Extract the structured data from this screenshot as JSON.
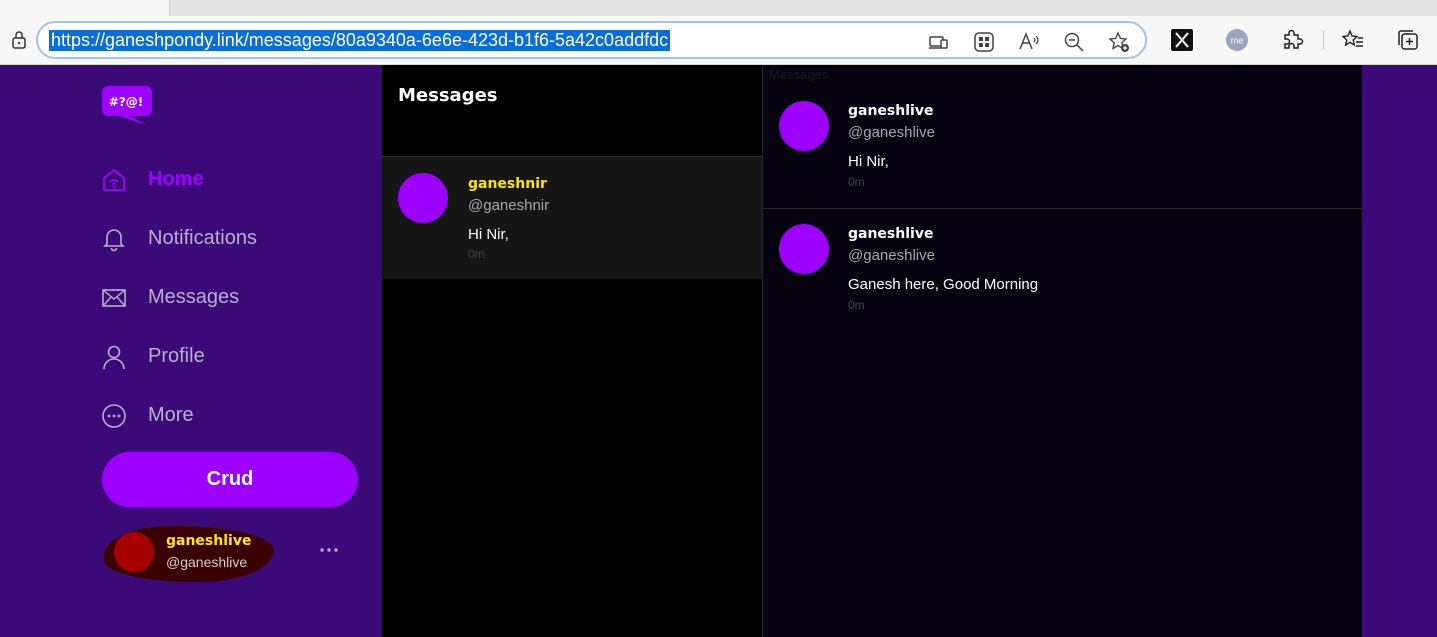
{
  "browser": {
    "url": "https://ganeshpondy.link/messages/80a9340a-6e6e-423d-b1f6-5a42c0addfdc",
    "toolbar_icons": [
      "app-available-icon",
      "apps-icon",
      "read-aloud-icon",
      "zoom-out-icon",
      "add-favorite-icon",
      "x-twitter-icon",
      "me-profile-icon",
      "extensions-icon",
      "favorites-icon",
      "collections-icon"
    ]
  },
  "colors": {
    "sidebar_bg": "#3c0a78",
    "accent": "#9d00ff",
    "highlight_name": "#ffe500"
  },
  "logo": {
    "text": "#?@!"
  },
  "nav": {
    "items": [
      {
        "label": "Home",
        "icon": "home-icon",
        "active": true
      },
      {
        "label": "Notifications",
        "icon": "bell-icon"
      },
      {
        "label": "Messages",
        "icon": "mail-icon"
      },
      {
        "label": "Profile",
        "icon": "user-icon"
      },
      {
        "label": "More",
        "icon": "more-circle-icon"
      }
    ]
  },
  "crud_button": {
    "label": "Crud"
  },
  "account": {
    "name": "ganeshlive",
    "handle": "@ganeshlive"
  },
  "conversations": {
    "title": "Messages",
    "items": [
      {
        "name": "ganeshnir",
        "handle": "@ganeshnir",
        "text": "Hi Nir,",
        "time": "0m"
      }
    ]
  },
  "thread": {
    "label": "Messages",
    "messages": [
      {
        "name": "ganeshlive",
        "handle": "@ganeshlive",
        "text": "Hi Nir,",
        "time": "0m"
      },
      {
        "name": "ganeshlive",
        "handle": "@ganeshlive",
        "text": "Ganesh here, Good Morning",
        "time": "0m"
      }
    ]
  }
}
